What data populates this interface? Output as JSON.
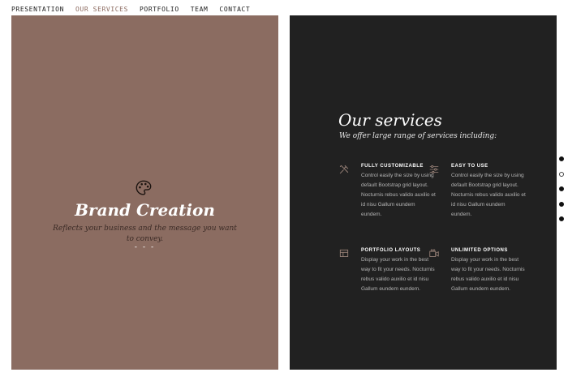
{
  "nav": {
    "items": [
      "PRESENTATION",
      "OUR SERVICES",
      "PORTFOLIO",
      "TEAM",
      "CONTACT"
    ]
  },
  "hero": {
    "icon": "palette-icon",
    "title": "Brand Creation",
    "description": "Reflects your business and the message you want to convey.",
    "dashes": "- - -"
  },
  "services": {
    "title": "Our services",
    "subtitle": "We offer large range of services including:",
    "features": [
      {
        "icon": "tools-icon",
        "title": "FULLY CUSTOMIZABLE",
        "text": "Control easily the size by using default Bootstrap grid layout. Nocturnis rebus valido auxilio et id nisu Gallum eundem eundem."
      },
      {
        "icon": "sliders-icon",
        "title": "EASY TO USE",
        "text": "Control easily the size by using default Bootstrap grid layout. Nocturnis rebus valido auxilio et id nisu Gallum eundem eundem."
      },
      {
        "icon": "layout-icon",
        "title": "PORTFOLIO LAYOUTS",
        "text": "Display your work in the best way to fit your needs. Nocturnis rebus valido auxilio et id nisu Gallum eundem eundem."
      },
      {
        "icon": "video-icon",
        "title": "UNLIMITED OPTIONS",
        "text": "Display your work in the best way to fit your needs. Nocturnis rebus valido auxilio et id nisu Gallum eundem eundem."
      }
    ]
  },
  "colors": {
    "left_panel": "#8b6c61",
    "right_panel": "#212121",
    "active_nav": "#8b6a5f"
  }
}
